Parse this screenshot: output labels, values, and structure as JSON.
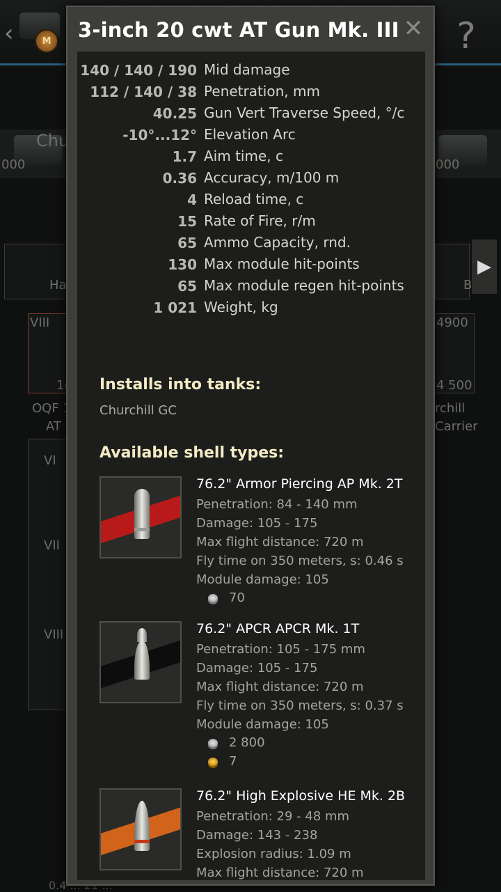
{
  "modal": {
    "title": "3-inch 20 cwt AT Gun Mk. III",
    "stats": [
      {
        "value": "140 / 140 / 190",
        "label": "Mid damage"
      },
      {
        "value": "112 / 140 / 38",
        "label": "Penetration, mm"
      },
      {
        "value": "40.25",
        "label": "Gun Vert Traverse Speed, °/c"
      },
      {
        "value": "-10°...12°",
        "label": "Elevation Arc"
      },
      {
        "value": "1.7",
        "label": "Aim time, c"
      },
      {
        "value": "0.36",
        "label": "Accuracy, m/100 m"
      },
      {
        "value": "4",
        "label": "Reload time, c"
      },
      {
        "value": "15",
        "label": "Rate of Fire, r/m"
      },
      {
        "value": "65",
        "label": "Ammo Capacity, rnd."
      },
      {
        "value": "130",
        "label": "Max module hit-points"
      },
      {
        "value": "65",
        "label": "Max module regen hit-points"
      },
      {
        "value": "1 021",
        "label": "Weight, kg"
      }
    ],
    "installs_title": "Installs into tanks:",
    "installs_tank": "Churchill GC",
    "shells_title": "Available shell types:",
    "shells": [
      {
        "name": "76.2\" Armor Piercing AP Mk. 2T",
        "lines": [
          "Penetration: 84 - 140 mm",
          "Damage: 105 - 175",
          "Max flight distance: 720 m",
          "Fly time on 350 meters, s: 0.46 s",
          "Module damage: 105"
        ],
        "credits": "70",
        "stripe_color": "#b81a1a"
      },
      {
        "name": "76.2\" APCR APCR Mk. 1T",
        "lines": [
          "Penetration: 105 - 175 mm",
          "Damage: 105 - 175",
          "Max flight distance: 720 m",
          "Fly time on 350 meters, s: 0.37 s",
          "Module damage: 105"
        ],
        "credits": "2 800",
        "gold": "7",
        "stripe_color": "#0d0d0d"
      },
      {
        "name": "76.2\" High Explosive HE Mk. 2B",
        "lines": [
          "Penetration: 29 - 48 mm",
          "Damage: 143 - 238",
          "Explosion radius: 1.09 m",
          "Max flight distance: 720 m"
        ],
        "stripe_color": "#d2631a"
      }
    ]
  },
  "background": {
    "tank_left": "Chu",
    "price_left": "000",
    "price_right": "000",
    "tier_viii": "VIII",
    "xp_right": "4900",
    "price_card_left": "1(",
    "price_card_right": "4 500",
    "module_left_1": "OQF 1",
    "module_left_2": "AT",
    "module_right_1": "rchill",
    "module_right_2": "Carrier",
    "tier_vi": "VI",
    "tier_vii": "VII",
    "tier_viii_2": "VIII",
    "tab_left": "Ha",
    "tab_right": "B",
    "bottom_partial": "0.4  ...  21 ..."
  }
}
